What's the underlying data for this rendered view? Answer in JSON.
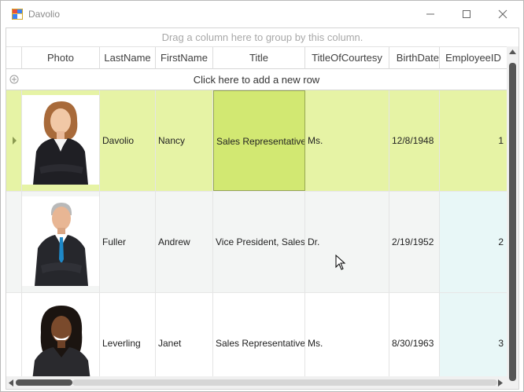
{
  "window": {
    "title": "Davolio",
    "app_icon": "app-grid-icon",
    "buttons": [
      "minimize-icon",
      "maximize-icon",
      "close-icon"
    ]
  },
  "grid": {
    "group_panel_text": "Drag a column here to group by this column.",
    "columns": [
      "Photo",
      "LastName",
      "FirstName",
      "Title",
      "TitleOfCourtesy",
      "BirthDate",
      "EmployeeID"
    ],
    "new_row_text": "Click here to add a new row",
    "rows": [
      {
        "photo": "employee-photo-woman",
        "last": "Davolio",
        "first": "Nancy",
        "title": "Sales Representative",
        "courtesy": "Ms.",
        "birth": "12/8/1948",
        "id": "1"
      },
      {
        "photo": "employee-photo-man",
        "last": "Fuller",
        "first": "Andrew",
        "title": "Vice President, Sales",
        "courtesy": "Dr.",
        "birth": "2/19/1952",
        "id": "2"
      },
      {
        "photo": "employee-photo-woman",
        "last": "Leverling",
        "first": "Janet",
        "title": "Sales Representative",
        "courtesy": "Ms.",
        "birth": "8/30/1963",
        "id": "3"
      }
    ],
    "selected_row": 0,
    "current_cell_column": "Title"
  },
  "colors": {
    "selected_row": "#e6f3a5",
    "current_cell": "#d2e872",
    "alt_row": "#f3f5f4",
    "id_column": "#e8f7f7"
  }
}
